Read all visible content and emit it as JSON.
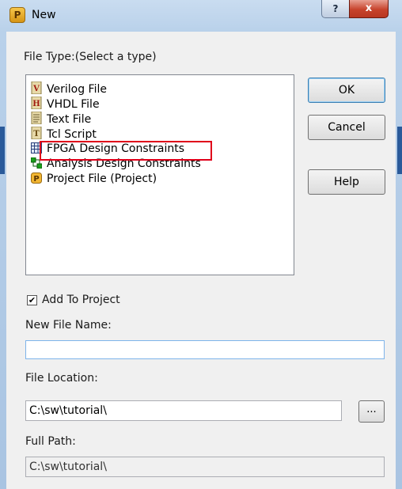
{
  "window": {
    "title": "New",
    "help_glyph": "?",
    "close_glyph": "x",
    "icon_letter": "P"
  },
  "file_type": {
    "label": "File Type:(Select a type)",
    "items": [
      {
        "label": "Verilog File",
        "icon": "verilog-icon"
      },
      {
        "label": "VHDL File",
        "icon": "vhdl-icon"
      },
      {
        "label": "Text File",
        "icon": "text-file-icon"
      },
      {
        "label": "Tcl Script",
        "icon": "tcl-script-icon"
      },
      {
        "label": "FPGA Design Constraints",
        "icon": "constraints-table-icon"
      },
      {
        "label": "Analysis Design Constraints",
        "icon": "analysis-constraints-icon"
      },
      {
        "label": "Project File (Project)",
        "icon": "project-file-icon"
      }
    ],
    "highlighted_item": "FPGA Design Constraints",
    "highlight_color": "#e0001a"
  },
  "buttons": {
    "ok": "OK",
    "cancel": "Cancel",
    "help": "Help",
    "browse": "..."
  },
  "add_to_project": {
    "label": "Add To Project",
    "checked": true,
    "check_glyph": "✔"
  },
  "new_file_name": {
    "label": "New File Name:",
    "value": ""
  },
  "file_location": {
    "label": "File Location:",
    "value": "C:\\sw\\tutorial\\"
  },
  "full_path": {
    "label": "Full Path:",
    "value": "C:\\sw\\tutorial\\"
  }
}
